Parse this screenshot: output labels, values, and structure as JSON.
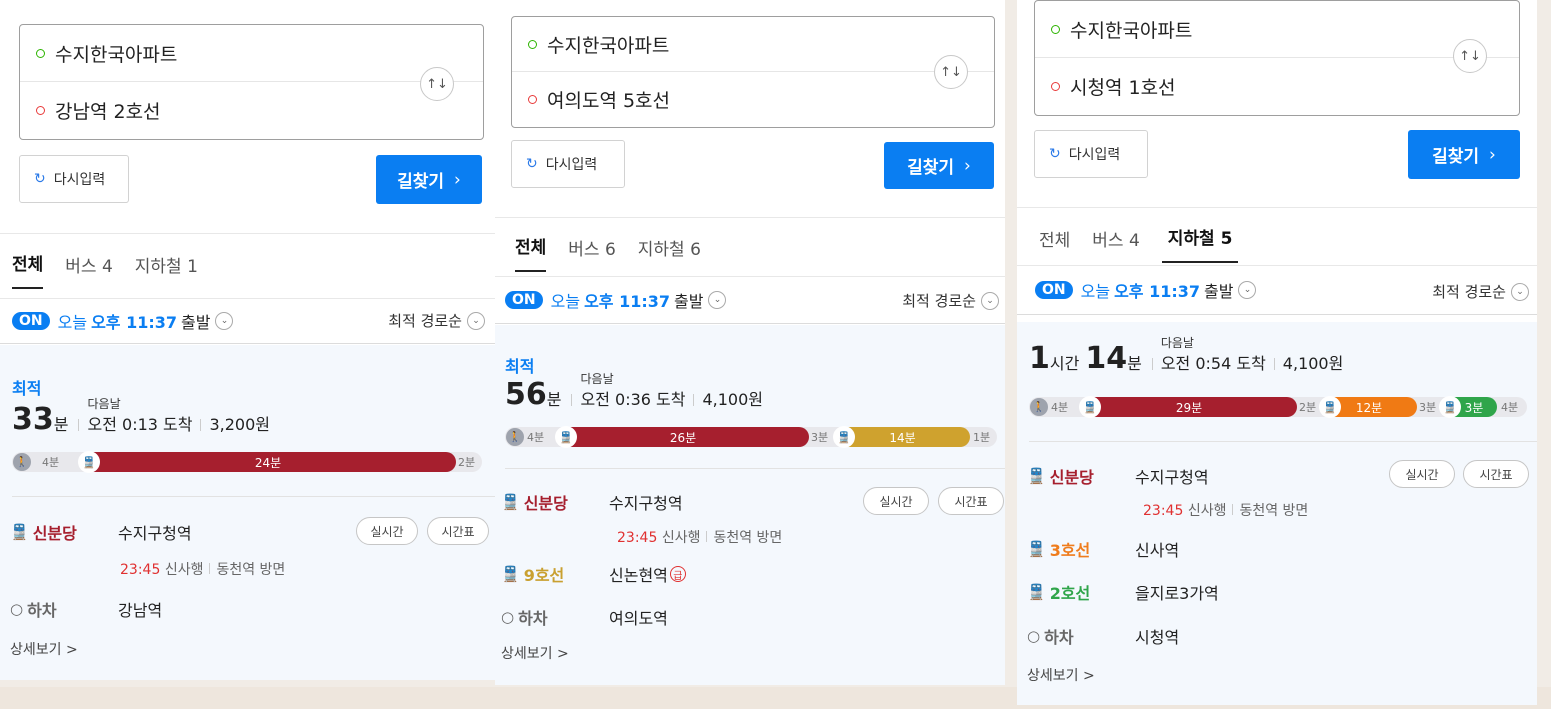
{
  "panels": [
    {
      "origin": "수지한국아파트",
      "destination": "강남역 2호선",
      "reset_label": "다시입력",
      "find_label": "길찾기",
      "tabs": [
        "전체",
        "버스 4",
        "지하철 1"
      ],
      "active_tab": 0,
      "depart": {
        "on": "ON",
        "today": "오늘",
        "time": "오후 11:37",
        "suffix": "출발"
      },
      "sort_label": "최적 경로순",
      "best_label": "최적",
      "duration": {
        "h": "",
        "h_unit": "",
        "m": "33",
        "m_unit": "분"
      },
      "next_day": "다음날",
      "arrive": "오전 0:13 도착",
      "fare": "3,200원",
      "bar": {
        "walk_start": "4분",
        "segs": [
          {
            "label": "24분",
            "color": "#a61f2e"
          }
        ],
        "gaps": [],
        "end": "2분"
      },
      "steps": [
        {
          "line": "신분당",
          "color": "#a61f2e",
          "station": "수지구청역"
        },
        {
          "line": "하차",
          "color": "#666666",
          "station": "강남역"
        }
      ],
      "realtime_label": "실시간",
      "timetable_label": "시간표",
      "sub_time": "23:45",
      "sub_bound": "신사행",
      "sub_dir": "동천역 방면",
      "detail_label": "상세보기 >"
    },
    {
      "origin": "수지한국아파트",
      "destination": "여의도역 5호선",
      "reset_label": "다시입력",
      "find_label": "길찾기",
      "tabs": [
        "전체",
        "버스 6",
        "지하철 6"
      ],
      "active_tab": 0,
      "depart": {
        "on": "ON",
        "today": "오늘",
        "time": "오후 11:37",
        "suffix": "출발"
      },
      "sort_label": "최적 경로순",
      "best_label": "최적",
      "duration": {
        "h": "",
        "h_unit": "",
        "m": "56",
        "m_unit": "분"
      },
      "next_day": "다음날",
      "arrive": "오전 0:36 도착",
      "fare": "4,100원",
      "bar": {
        "walk_start": "4분",
        "segs": [
          {
            "label": "26분",
            "color": "#a61f2e"
          },
          {
            "label": "14분",
            "color": "#cfa22e"
          }
        ],
        "gaps": [
          "3분"
        ],
        "end": "1분"
      },
      "steps": [
        {
          "line": "신분당",
          "color": "#a61f2e",
          "station": "수지구청역"
        },
        {
          "line": "9호선",
          "color": "#c9a030",
          "station": "신논현역"
        },
        {
          "line": "하차",
          "color": "#666666",
          "station": "여의도역"
        }
      ],
      "express_mark": "급",
      "realtime_label": "실시간",
      "timetable_label": "시간표",
      "sub_time": "23:45",
      "sub_bound": "신사행",
      "sub_dir": "동천역 방면",
      "detail_label": "상세보기 >"
    },
    {
      "origin": "수지한국아파트",
      "destination": "시청역 1호선",
      "reset_label": "다시입력",
      "find_label": "길찾기",
      "tabs": [
        "전체",
        "버스 4",
        "지하철 5"
      ],
      "active_tab": 2,
      "depart": {
        "on": "ON",
        "today": "오늘",
        "time": "오후 11:37",
        "suffix": "출발"
      },
      "sort_label": "최적 경로순",
      "best_label": "",
      "duration": {
        "h": "1",
        "h_unit": "시간",
        "m": "14",
        "m_unit": "분"
      },
      "next_day": "다음날",
      "arrive": "오전 0:54 도착",
      "fare": "4,100원",
      "bar": {
        "walk_start": "4분",
        "segs": [
          {
            "label": "29분",
            "color": "#a61f2e"
          },
          {
            "label": "12분",
            "color": "#f07a14"
          },
          {
            "label": "3분",
            "color": "#2fa54a"
          }
        ],
        "gaps": [
          "2분",
          "3분"
        ],
        "end": "4분"
      },
      "steps": [
        {
          "line": "신분당",
          "color": "#a61f2e",
          "station": "수지구청역"
        },
        {
          "line": "3호선",
          "color": "#ef7c1c",
          "station": "신사역"
        },
        {
          "line": "2호선",
          "color": "#2fa54a",
          "station": "을지로3가역"
        },
        {
          "line": "하차",
          "color": "#666666",
          "station": "시청역"
        }
      ],
      "realtime_label": "실시간",
      "timetable_label": "시간표",
      "sub_time": "23:45",
      "sub_bound": "신사행",
      "sub_dir": "동천역 방면",
      "detail_label": "상세보기 >"
    }
  ],
  "colors": {
    "accent": "#0a7ef2",
    "shinbundang": "#a61f2e",
    "line9": "#cfa22e",
    "line3": "#f07a14",
    "line2": "#2fa54a"
  }
}
